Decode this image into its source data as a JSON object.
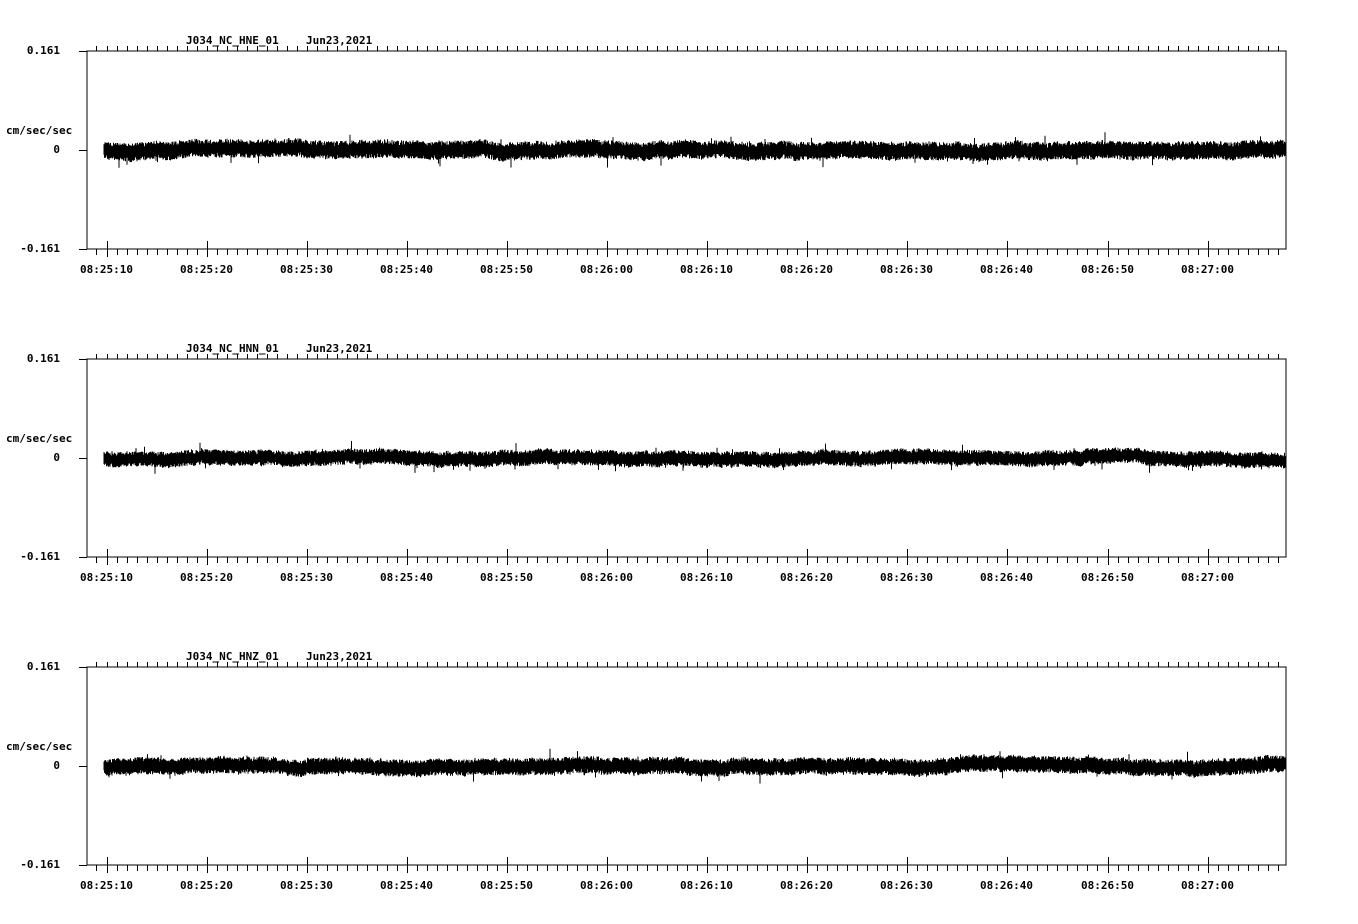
{
  "chart_data": [
    {
      "type": "line",
      "title": "J034_NC_HNE_01",
      "date": "Jun23,2021",
      "ylabel": "cm/sec/sec",
      "ylim": [
        -0.161,
        0.161
      ],
      "yticks": [
        "0.161",
        "0",
        "-0.161"
      ],
      "xticks": [
        "08:25:10",
        "08:25:20",
        "08:25:30",
        "08:25:40",
        "08:25:50",
        "08:26:00",
        "08:26:10",
        "08:26:20",
        "08:26:30",
        "08:26:40",
        "08:26:50",
        "08:27:00"
      ],
      "xlim_seconds_from_first_tick": [
        -2,
        117.7
      ],
      "noise_amplitude": 0.015,
      "noise_seed": 11,
      "grid": false
    },
    {
      "type": "line",
      "title": "J034_NC_HNN_01",
      "date": "Jun23,2021",
      "ylabel": "cm/sec/sec",
      "ylim": [
        -0.161,
        0.161
      ],
      "yticks": [
        "0.161",
        "0",
        "-0.161"
      ],
      "xticks": [
        "08:25:10",
        "08:25:20",
        "08:25:30",
        "08:25:40",
        "08:25:50",
        "08:26:00",
        "08:26:10",
        "08:26:20",
        "08:26:30",
        "08:26:40",
        "08:26:50",
        "08:27:00"
      ],
      "xlim_seconds_from_first_tick": [
        -2,
        117.7
      ],
      "noise_amplitude": 0.013,
      "noise_seed": 23,
      "grid": false
    },
    {
      "type": "line",
      "title": "J034_NC_HNZ_01",
      "date": "Jun23,2021",
      "ylabel": "cm/sec/sec",
      "ylim": [
        -0.161,
        0.161
      ],
      "yticks": [
        "0.161",
        "0",
        "-0.161"
      ],
      "xticks": [
        "08:25:10",
        "08:25:20",
        "08:25:30",
        "08:25:40",
        "08:25:50",
        "08:26:00",
        "08:26:10",
        "08:26:20",
        "08:26:30",
        "08:26:40",
        "08:26:50",
        "08:27:00"
      ],
      "xlim_seconds_from_first_tick": [
        -2,
        117.7
      ],
      "noise_amplitude": 0.014,
      "noise_seed": 37,
      "grid": false
    }
  ],
  "colors": {
    "trace": "#000000",
    "background": "#ffffff",
    "axis": "#000000"
  }
}
